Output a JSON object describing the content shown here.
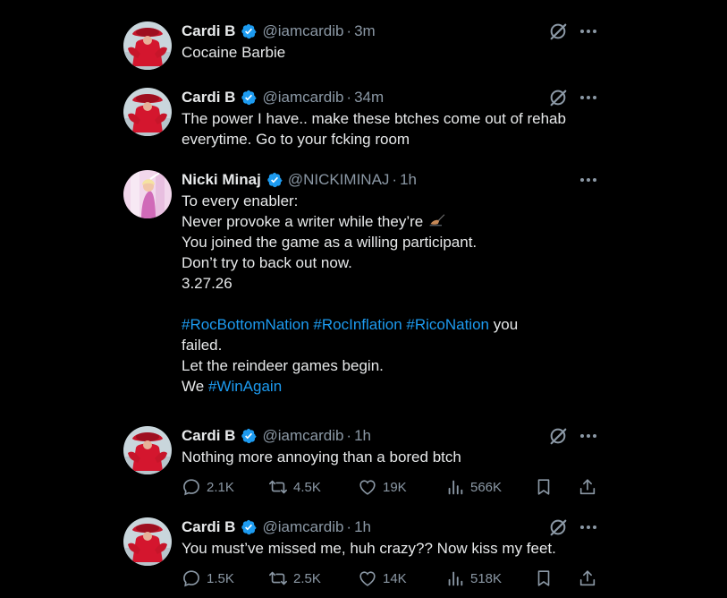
{
  "tweets": [
    {
      "name": "Cardi B",
      "handle": "@iamcardib",
      "time": "3m",
      "lines": [
        "Cocaine Barbie"
      ]
    },
    {
      "name": "Cardi B",
      "handle": "@iamcardib",
      "time": "34m",
      "lines": [
        "The power I have.. make these btches come out of rehab",
        "everytime. Go to your fcking room"
      ]
    },
    {
      "name": "Nicki Minaj",
      "handle": "@NICKIMINAJ",
      "time": "1h",
      "lines": [
        "To every enabler:",
        "Never provoke a writer while they’re",
        "You joined the game as a willing participant.",
        "Don’t try to back out now.",
        "3.27.26"
      ],
      "hashtags": [
        "#RocBottomNation",
        "#RocInflation",
        "#RicoNation"
      ],
      "hashtag_tail": "you",
      "line_failed": "failed.",
      "line_reindeer": "Let the reindeer games begin.",
      "we": "We",
      "win_tag": "#WinAgain"
    },
    {
      "name": "Cardi B",
      "handle": "@iamcardib",
      "time": "1h",
      "lines": [
        "Nothing more annoying than a bored btch"
      ],
      "stats": {
        "replies": "2.1K",
        "reposts": "4.5K",
        "likes": "19K",
        "views": "566K"
      }
    },
    {
      "name": "Cardi B",
      "handle": "@iamcardib",
      "time": "1h",
      "lines": [
        "You must’ve missed me, huh crazy?? Now kiss my feet."
      ],
      "stats": {
        "replies": "1.5K",
        "reposts": "2.5K",
        "likes": "14K",
        "views": "518K"
      }
    }
  ],
  "colors": {
    "background": "#000000",
    "text": "#e7e9ea",
    "secondary": "#8b98a5",
    "link": "#1d9bf0",
    "verified": "#1d9bf0"
  },
  "icons": [
    "verified-badge-icon",
    "grok-icon",
    "more-icon",
    "reply-icon",
    "repost-icon",
    "like-icon",
    "views-icon",
    "bookmark-icon",
    "share-icon",
    "writing-hand-emoji"
  ]
}
